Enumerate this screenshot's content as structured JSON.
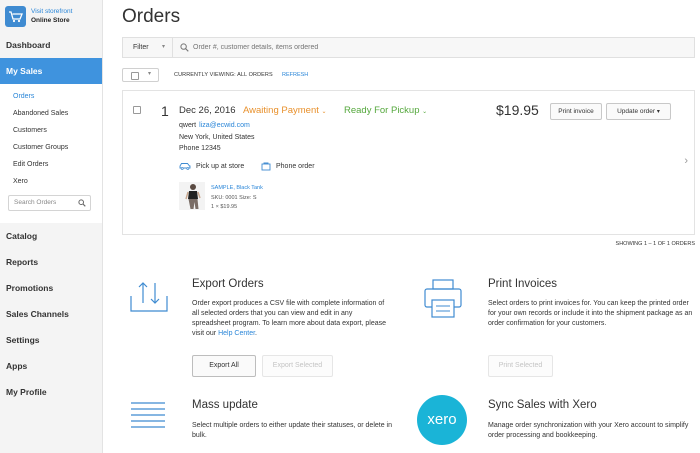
{
  "store": {
    "visit_label": "Visit storefront",
    "name": "Online Store"
  },
  "nav": {
    "dashboard": "Dashboard",
    "my_sales": "My Sales",
    "sub": [
      "Orders",
      "Abandoned Sales",
      "Customers",
      "Customer Groups",
      "Edit Orders",
      "Xero"
    ],
    "search_placeholder": "Search Orders",
    "lower": [
      "Catalog",
      "Reports",
      "Promotions",
      "Sales Channels",
      "Settings",
      "Apps",
      "My Profile"
    ]
  },
  "page": {
    "title": "Orders",
    "filter_label": "Filter",
    "search_placeholder": "Order #, customer details, items ordered",
    "viewing_text": "CURRENTLY VIEWING: ALL ORDERS",
    "refresh_label": "REFRESH",
    "showing_text": "SHOWING 1 – 1 OF 1 ORDERS"
  },
  "order": {
    "number": "1",
    "date": "Dec 26, 2016",
    "payment_status": "Awaiting Payment",
    "fulfillment_status": "Ready For Pickup",
    "customer_name": "qwert",
    "customer_email": "liza@ecwid.com",
    "address_line1": "New York, United States",
    "address_line2": "Phone 12345",
    "shipping": "Pick up at store",
    "order_type": "Phone order",
    "product_name": "SAMPLE, Black Tank",
    "product_sku": "SKU: 0001    Size: S",
    "product_qty": "1 × $19.95",
    "total": "$19.95",
    "print_label": "Print invoice",
    "update_label": "Update order"
  },
  "export": {
    "title": "Export Orders",
    "desc_before_link": "Order export produces a CSV file with complete information of all selected orders that you can view and edit in any spreadsheet program. To learn more about data export, please visit our ",
    "link": "Help Center",
    "desc_after_link": ".",
    "export_all": "Export All",
    "export_selected": "Export Selected"
  },
  "print": {
    "title": "Print Invoices",
    "desc": "Select orders to print invoices for. You can keep the printed order for your own records or include it into the shipment package as an order confirmation for your customers.",
    "print_selected": "Print Selected"
  },
  "mass": {
    "title": "Mass update",
    "desc": "Select multiple orders to either update their statuses, or delete in bulk."
  },
  "xero": {
    "logo_text": "xero",
    "title": "Sync Sales with Xero",
    "desc": "Manage order synchronization with your Xero account to simplify order processing and bookkeeping."
  },
  "colors": {
    "accent": "#3f93de",
    "link": "#2a86d8",
    "awaiting": "#e8912d",
    "ready": "#55a83d",
    "xero": "#1ab4d7"
  }
}
